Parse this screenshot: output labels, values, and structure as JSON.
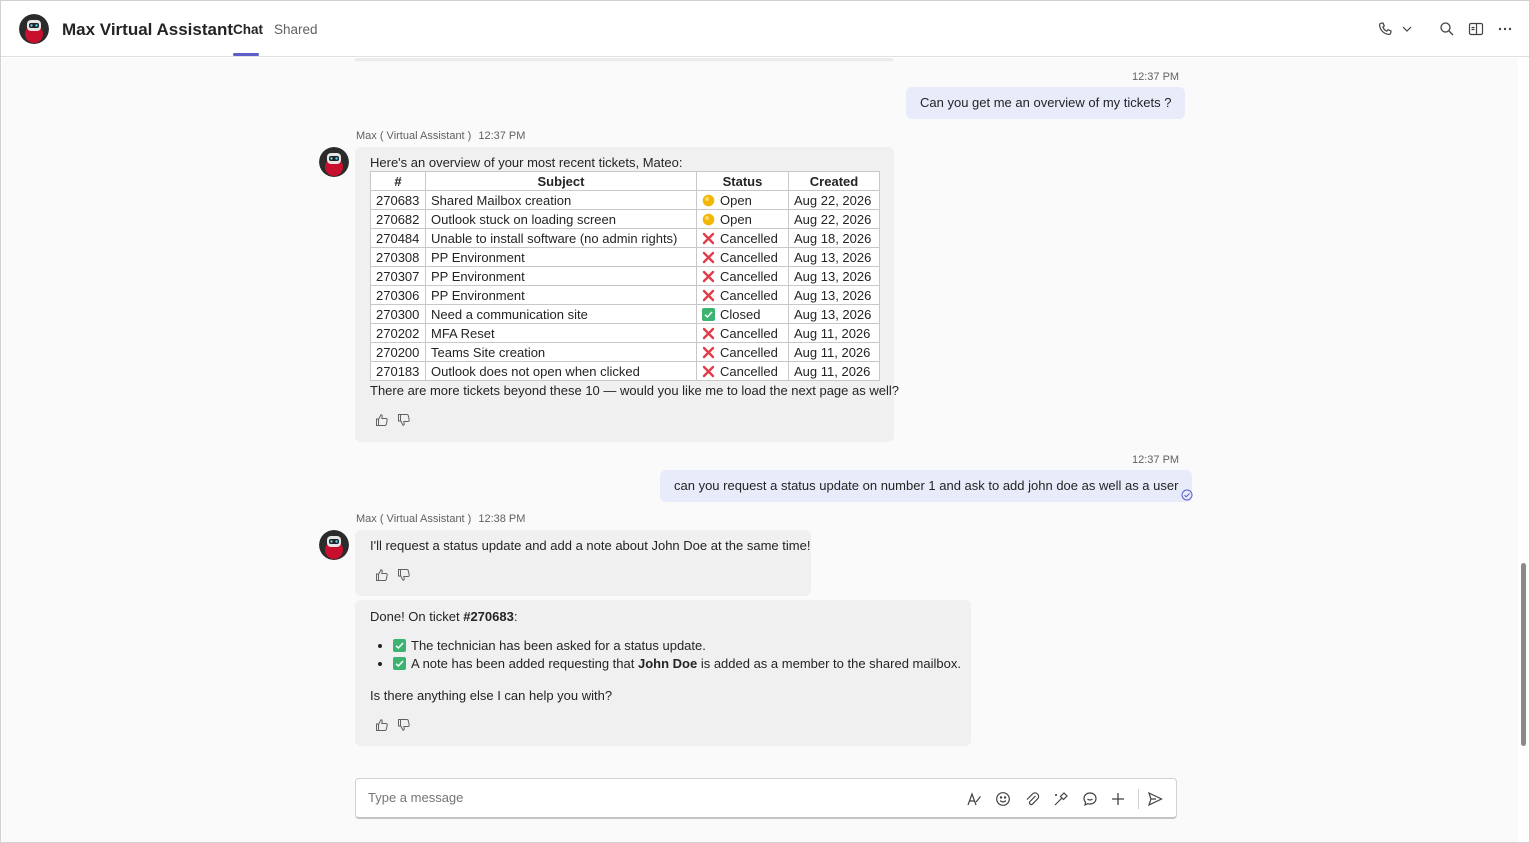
{
  "header": {
    "title": "Max Virtual Assistant",
    "tabs": [
      {
        "label": "Chat",
        "active": true
      },
      {
        "label": "Shared",
        "active": false
      }
    ],
    "icons": [
      "phone-icon",
      "chevron-down-icon",
      "search-icon",
      "popout-icon",
      "more-icon"
    ]
  },
  "colors": {
    "accent": "#5b5fc7",
    "my_bubble": "#e8ebfa",
    "bot_bubble": "#f0f0f0",
    "cancelled": "#e03c4b",
    "closed": "#3cb371",
    "open": "#f2b705"
  },
  "messages": {
    "m1": {
      "time": "12:37 PM",
      "text": "Can you get me an overview of my tickets ?"
    },
    "m2": {
      "sender": "Max ( Virtual Assistant )",
      "time": "12:37 PM",
      "intro": "Here's an overview of your most recent tickets, Mateo:",
      "columns": [
        "#",
        "Subject",
        "Status",
        "Created"
      ],
      "rows": [
        {
          "id": "270683",
          "subject": "Shared Mailbox creation",
          "status": "Open",
          "status_icon": "open-dot-icon",
          "created": "Aug 22, 2026"
        },
        {
          "id": "270682",
          "subject": "Outlook stuck on loading screen",
          "status": "Open",
          "status_icon": "open-dot-icon",
          "created": "Aug 22, 2026"
        },
        {
          "id": "270484",
          "subject": "Unable to install software (no admin rights)",
          "status": "Cancelled",
          "status_icon": "cross-icon",
          "created": "Aug 18, 2026"
        },
        {
          "id": "270308",
          "subject": "PP Environment",
          "status": "Cancelled",
          "status_icon": "cross-icon",
          "created": "Aug 13, 2026"
        },
        {
          "id": "270307",
          "subject": "PP Environment",
          "status": "Cancelled",
          "status_icon": "cross-icon",
          "created": "Aug 13, 2026"
        },
        {
          "id": "270306",
          "subject": "PP Environment",
          "status": "Cancelled",
          "status_icon": "cross-icon",
          "created": "Aug 13, 2026"
        },
        {
          "id": "270300",
          "subject": "Need a communication site",
          "status": "Closed",
          "status_icon": "check-icon",
          "created": "Aug 13, 2026"
        },
        {
          "id": "270202",
          "subject": "MFA Reset",
          "status": "Cancelled",
          "status_icon": "cross-icon",
          "created": "Aug 11, 2026"
        },
        {
          "id": "270200",
          "subject": "Teams Site creation",
          "status": "Cancelled",
          "status_icon": "cross-icon",
          "created": "Aug 11, 2026"
        },
        {
          "id": "270183",
          "subject": "Outlook does not open when clicked",
          "status": "Cancelled",
          "status_icon": "cross-icon",
          "created": "Aug 11, 2026"
        }
      ],
      "outro": "There are more tickets beyond these 10 — would you like me to load the next page as well?"
    },
    "m3": {
      "time": "12:37 PM",
      "text": "can you request a status update on number 1  and ask to add john doe as well as a user"
    },
    "m4": {
      "sender": "Max ( Virtual Assistant )",
      "time": "12:38 PM",
      "text": "I'll request a status update and add a note about John Doe at the same time!"
    },
    "m5": {
      "done_prefix": "Done! On ticket ",
      "ticket": "#270683",
      "done_suffix": ":",
      "item1": "The technician has been asked for a status update.",
      "item2_prefix": "A note has been added requesting that ",
      "item2_bold": "John Doe",
      "item2_suffix": " is added as a member to the shared mailbox.",
      "closing": "Is there anything else I can help you with?"
    }
  },
  "composer": {
    "placeholder": "Type a message",
    "icons": [
      "format-icon",
      "emoji-icon",
      "attach-icon",
      "loop-icon",
      "copilot-icon",
      "add-icon",
      "send-icon"
    ]
  }
}
